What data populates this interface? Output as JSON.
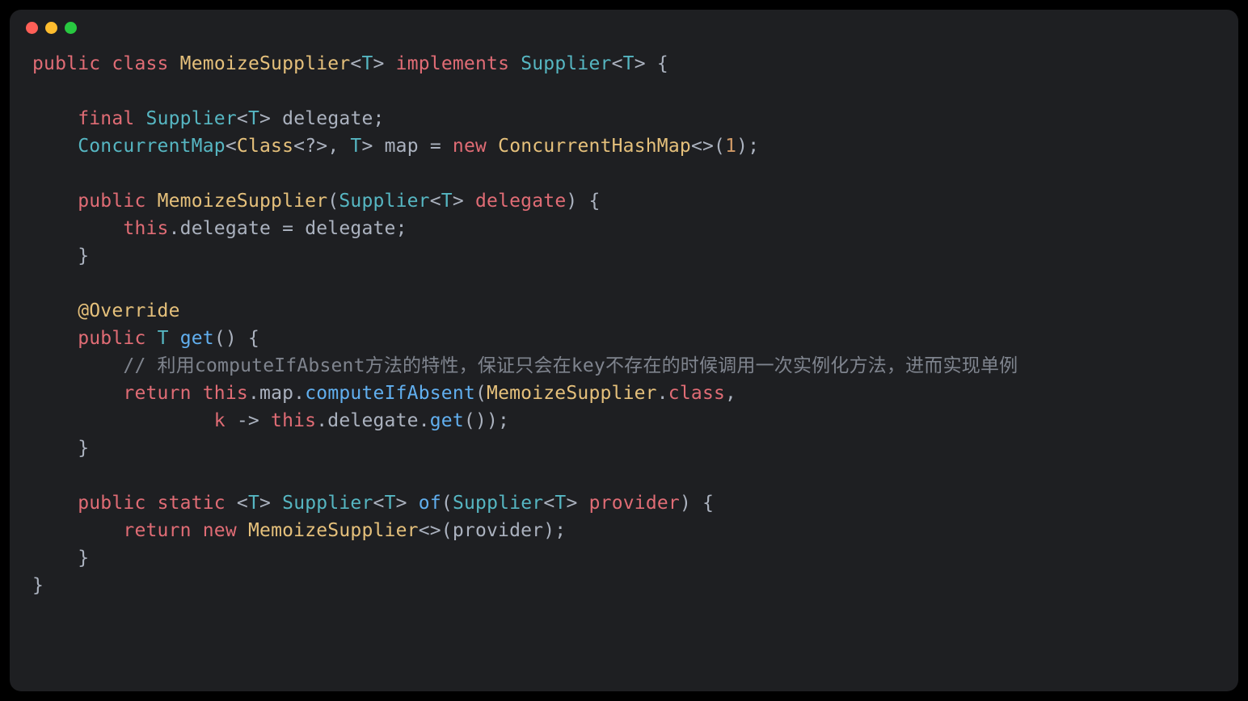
{
  "code": {
    "line01": {
      "t1": "public",
      "t2": " ",
      "t3": "class",
      "t4": " ",
      "t5": "MemoizeSupplier",
      "t6": "<",
      "t7": "T",
      "t8": ">",
      "t9": " ",
      "t10": "implements",
      "t11": " ",
      "t12": "Supplier",
      "t13": "<",
      "t14": "T",
      "t15": ">",
      "t16": " {"
    },
    "line02": "",
    "line03": {
      "indent": "    ",
      "t1": "final",
      "t2": " ",
      "t3": "Supplier",
      "t4": "<",
      "t5": "T",
      "t6": ">",
      "t7": " ",
      "t8": "delegate",
      "t9": ";"
    },
    "line04": {
      "indent": "    ",
      "t1": "ConcurrentMap",
      "t2": "<",
      "t3": "Class",
      "t4": "<",
      "t5": "?",
      "t6": ">, ",
      "t7": "T",
      "t8": ">",
      "t9": " ",
      "t10": "map",
      "t11": " = ",
      "t12": "new",
      "t13": " ",
      "t14": "ConcurrentHashMap",
      "t15": "<>(",
      "t16": "1",
      "t17": ");"
    },
    "line05": "",
    "line06": {
      "indent": "    ",
      "t1": "public",
      "t2": " ",
      "t3": "MemoizeSupplier",
      "t4": "(",
      "t5": "Supplier",
      "t6": "<",
      "t7": "T",
      "t8": ">",
      "t9": " ",
      "t10": "delegate",
      "t11": ") {"
    },
    "line07": {
      "indent": "        ",
      "t1": "this",
      "t2": ".",
      "t3": "delegate",
      "t4": " = ",
      "t5": "delegate",
      "t6": ";"
    },
    "line08": {
      "indent": "    ",
      "t1": "}"
    },
    "line09": "",
    "line10": {
      "indent": "    ",
      "t1": "@Override"
    },
    "line11": {
      "indent": "    ",
      "t1": "public",
      "t2": " ",
      "t3": "T",
      "t4": " ",
      "t5": "get",
      "t6": "() {"
    },
    "line12": {
      "indent": "        ",
      "t1": "// 利用computeIfAbsent方法的特性，保证只会在key不存在的时候调用一次实例化方法，进而实现单例"
    },
    "line13": {
      "indent": "        ",
      "t1": "return",
      "t2": " ",
      "t3": "this",
      "t4": ".",
      "t5": "map",
      "t6": ".",
      "t7": "computeIfAbsent",
      "t8": "(",
      "t9": "MemoizeSupplier",
      "t10": ".",
      "t11": "class",
      "t12": ","
    },
    "line14": {
      "indent": "                ",
      "t1": "k",
      "t2": " -> ",
      "t3": "this",
      "t4": ".",
      "t5": "delegate",
      "t6": ".",
      "t7": "get",
      "t8": "());"
    },
    "line15": {
      "indent": "    ",
      "t1": "}"
    },
    "line16": "",
    "line17": {
      "indent": "    ",
      "t1": "public",
      "t2": " ",
      "t3": "static",
      "t4": " <",
      "t5": "T",
      "t6": "> ",
      "t7": "Supplier",
      "t8": "<",
      "t9": "T",
      "t10": ">",
      "t11": " ",
      "t12": "of",
      "t13": "(",
      "t14": "Supplier",
      "t15": "<",
      "t16": "T",
      "t17": ">",
      "t18": " ",
      "t19": "provider",
      "t20": ") {"
    },
    "line18": {
      "indent": "        ",
      "t1": "return",
      "t2": " ",
      "t3": "new",
      "t4": " ",
      "t5": "MemoizeSupplier",
      "t6": "<>(",
      "t7": "provider",
      "t8": ");"
    },
    "line19": {
      "indent": "    ",
      "t1": "}"
    },
    "line20": {
      "t1": "}"
    }
  }
}
